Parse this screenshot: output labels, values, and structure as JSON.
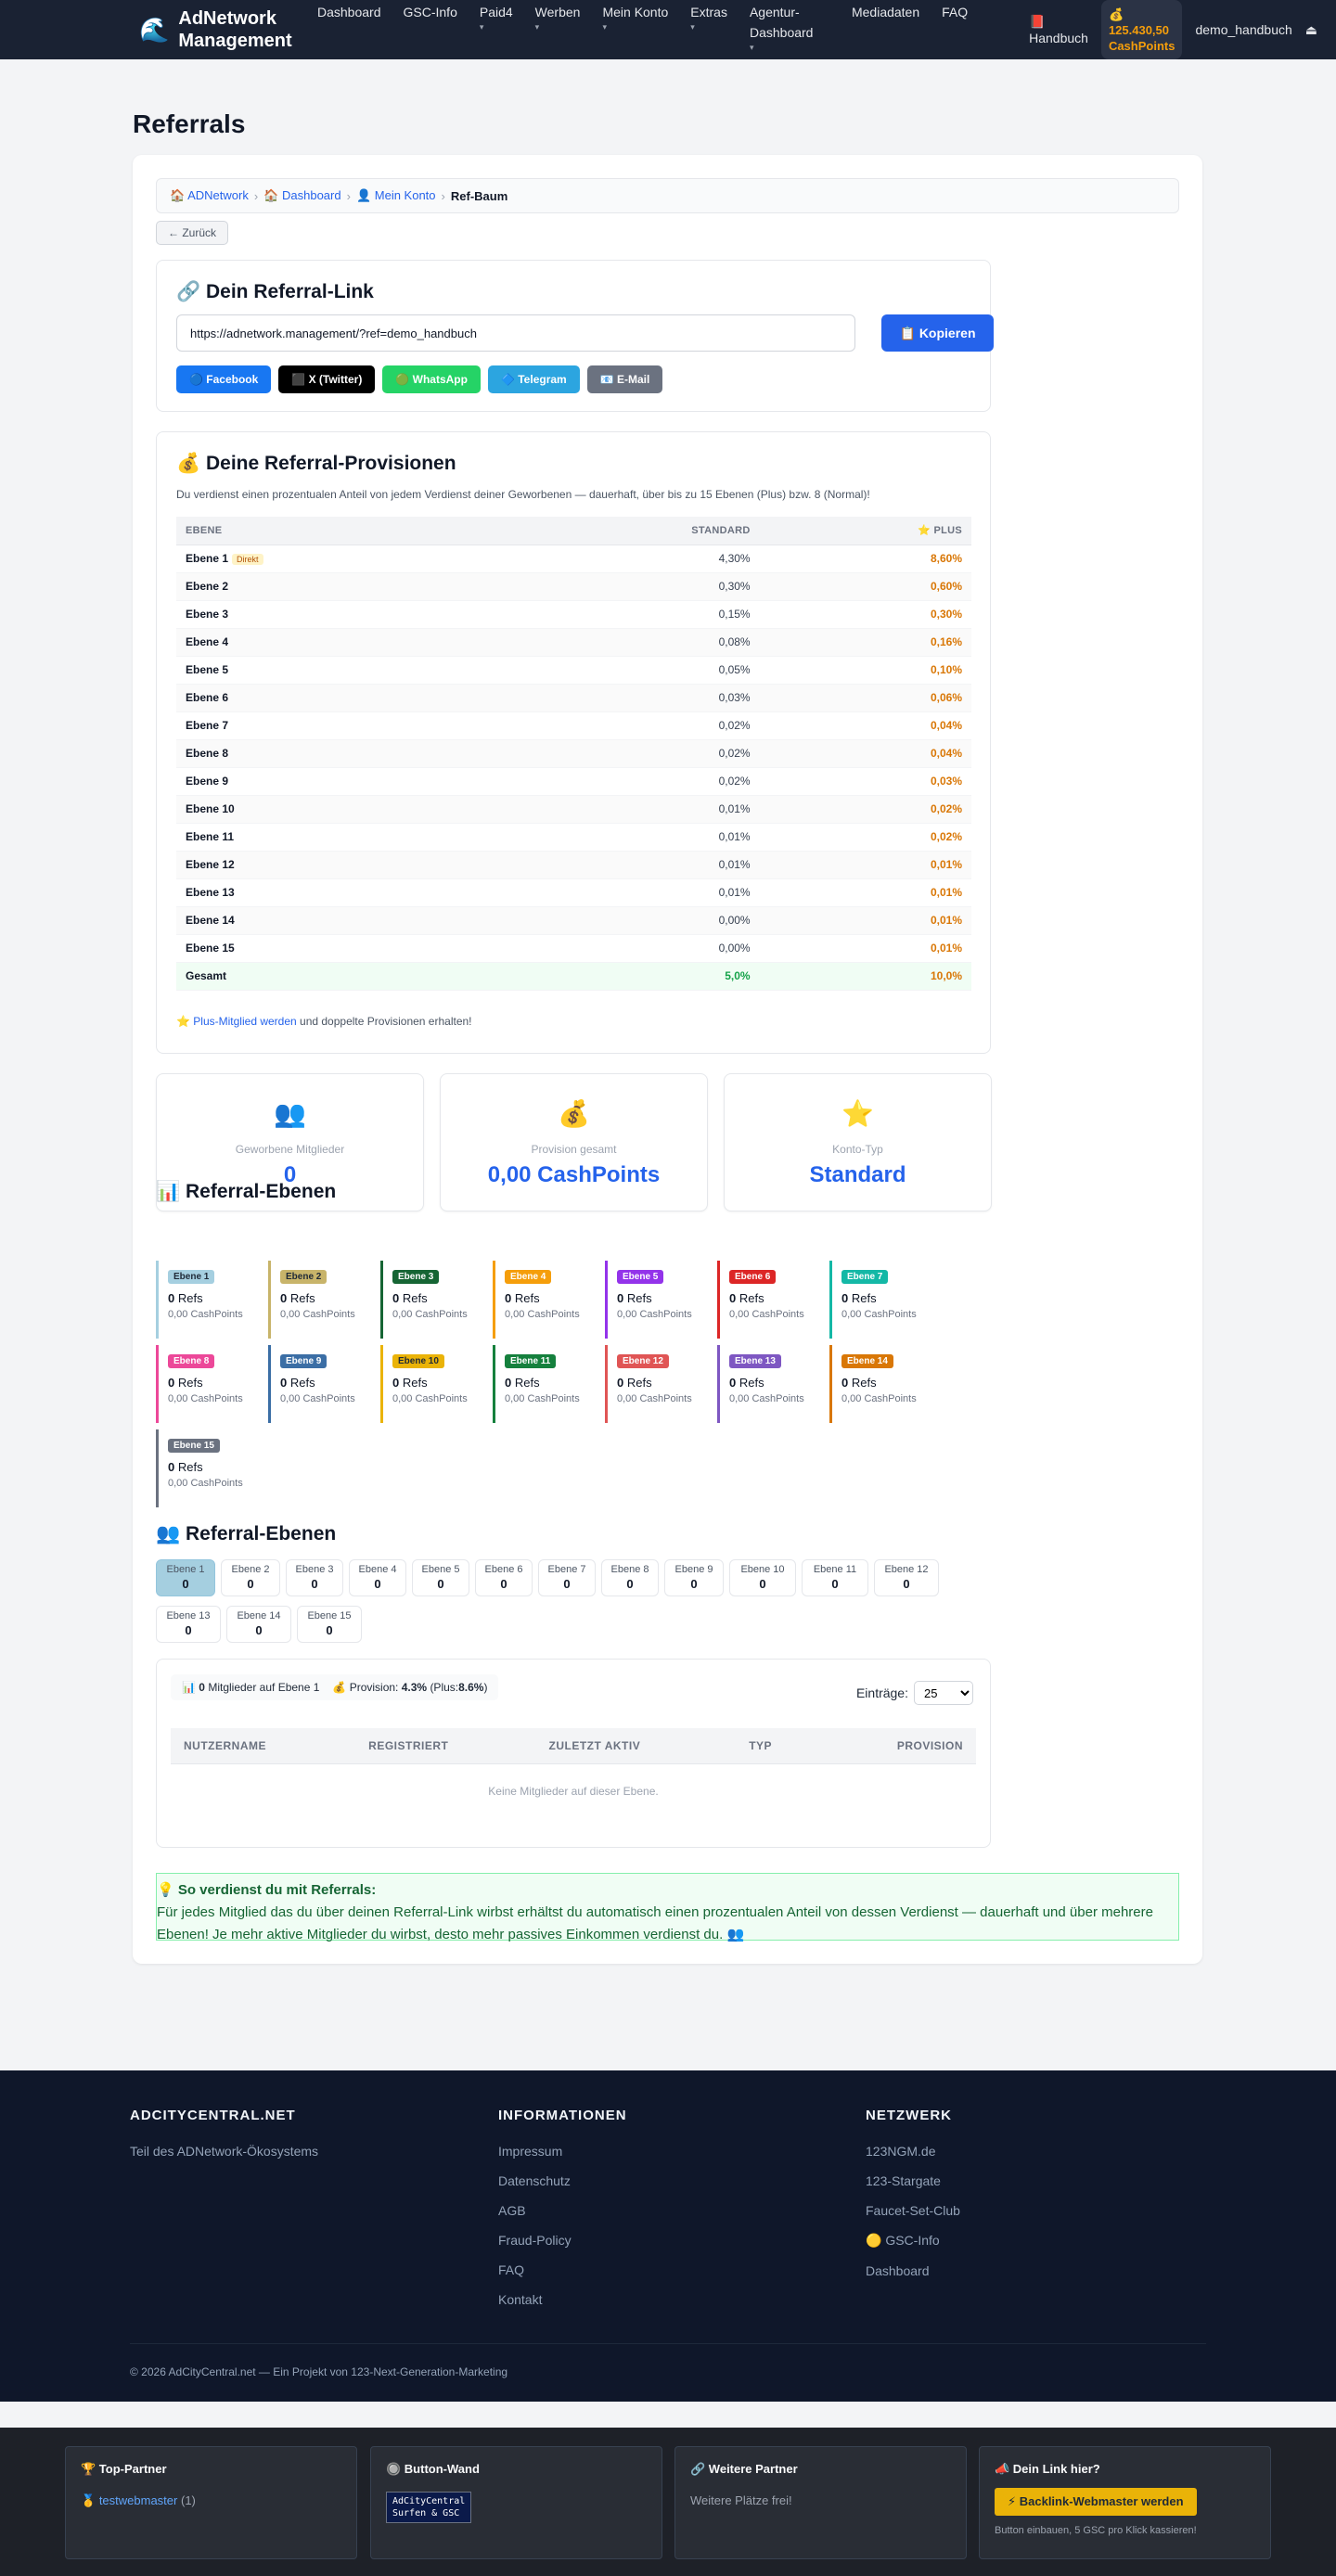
{
  "nav": {
    "brand_icon": "🌊",
    "brand_title": "AdNetwork Management",
    "items": [
      {
        "label": "Dashboard",
        "caret": ""
      },
      {
        "label": "GSC-Info",
        "caret": ""
      },
      {
        "label": "Paid4",
        "caret": "▾"
      },
      {
        "label": "Werben",
        "caret": "▾"
      },
      {
        "label": "Mein Konto",
        "caret": "▾"
      },
      {
        "label": "Extras",
        "caret": "▾"
      },
      {
        "label": "Agentur-Dashboard",
        "caret": "▾"
      },
      {
        "label": "Mediadaten",
        "caret": ""
      },
      {
        "label": "FAQ",
        "caret": ""
      }
    ],
    "handbook_icon": "📕",
    "handbook": "Handbuch",
    "cash_icon": "💰",
    "cash_amount": "125.430,50",
    "cash_unit": "CashPoints",
    "user": "demo_handbuch",
    "logout_icon": "⏏"
  },
  "page": {
    "title": "Referrals"
  },
  "breadcrumb": [
    {
      "icon": "🏠",
      "label": "ADNetwork"
    },
    {
      "icon": "🏠",
      "label": "Dashboard"
    },
    {
      "icon": "👤",
      "label": "Mein Konto"
    },
    {
      "label": "Ref-Baum"
    }
  ],
  "back_label": "← Zurück",
  "ref_link": {
    "title": "🔗 Dein Referral-Link",
    "url": "https://adnetwork.management/?ref=demo_handbuch",
    "copy_label": "📋 Kopieren",
    "share": [
      {
        "label": "🔵 Facebook",
        "color": "#1877f2"
      },
      {
        "label": "⬛ X (Twitter)",
        "color": "#000000"
      },
      {
        "label": "🟢 WhatsApp",
        "color": "#25d366"
      },
      {
        "label": "🔷 Telegram",
        "color": "#2ca5e0"
      },
      {
        "label": "📧 E-Mail",
        "color": "#6b7280"
      }
    ]
  },
  "provisions": {
    "title": "💰 Deine Referral-Provisionen",
    "description": "Du verdienst einen prozentualen Anteil von jedem Verdienst deiner Geworbenen — dauerhaft, über bis zu 15 Ebenen (Plus) bzw. 8 (Normal)!",
    "headers": {
      "level": "Ebene",
      "standard": "Standard",
      "plus": "⭐ Plus"
    },
    "direkt_label": "Direkt",
    "rows": [
      {
        "level": "Ebene 1",
        "standard": "4,30%",
        "plus": "8,60%"
      },
      {
        "level": "Ebene 2",
        "standard": "0,30%",
        "plus": "0,60%"
      },
      {
        "level": "Ebene 3",
        "standard": "0,15%",
        "plus": "0,30%"
      },
      {
        "level": "Ebene 4",
        "standard": "0,08%",
        "plus": "0,16%"
      },
      {
        "level": "Ebene 5",
        "standard": "0,05%",
        "plus": "0,10%"
      },
      {
        "level": "Ebene 6",
        "standard": "0,03%",
        "plus": "0,06%"
      },
      {
        "level": "Ebene 7",
        "standard": "0,02%",
        "plus": "0,04%"
      },
      {
        "level": "Ebene 8",
        "standard": "0,02%",
        "plus": "0,04%"
      },
      {
        "level": "Ebene 9",
        "standard": "0,02%",
        "plus": "0,03%"
      },
      {
        "level": "Ebene 10",
        "standard": "0,01%",
        "plus": "0,02%"
      },
      {
        "level": "Ebene 11",
        "standard": "0,01%",
        "plus": "0,02%"
      },
      {
        "level": "Ebene 12",
        "standard": "0,01%",
        "plus": "0,01%"
      },
      {
        "level": "Ebene 13",
        "standard": "0,01%",
        "plus": "0,01%"
      },
      {
        "level": "Ebene 14",
        "standard": "0,00%",
        "plus": "0,01%"
      },
      {
        "level": "Ebene 15",
        "standard": "0,00%",
        "plus": "0,01%"
      }
    ],
    "total": {
      "level": "Gesamt",
      "standard": "5,0%",
      "plus": "10,0%"
    },
    "plus_note_star": "⭐",
    "plus_note_link": "Plus-Mitglied werden",
    "plus_note_text": "und doppelte Provisionen erhalten!"
  },
  "stats": [
    {
      "icon": "👥",
      "label": "Geworbene Mitglieder",
      "value": "0"
    },
    {
      "icon": "💰",
      "label": "Provision gesamt",
      "value": "0,00 CashPoints"
    },
    {
      "icon": "⭐",
      "label": "Konto-Typ",
      "value": "Standard"
    }
  ],
  "levels_section": {
    "title": "📊 Referral-Ebenen",
    "refs_label": "Refs",
    "cards": [
      {
        "name": "Ebene 1",
        "refs": "0",
        "cash": "0,00 CashPoints",
        "color": "#a5cfe0",
        "text": "#1f2937"
      },
      {
        "name": "Ebene 2",
        "refs": "0",
        "cash": "0,00 CashPoints",
        "color": "#c8b46a",
        "text": "#1f2937"
      },
      {
        "name": "Ebene 3",
        "refs": "0",
        "cash": "0,00 CashPoints",
        "color": "#166534",
        "text": "#ffffff"
      },
      {
        "name": "Ebene 4",
        "refs": "0",
        "cash": "0,00 CashPoints",
        "color": "#f59e0b",
        "text": "#ffffff"
      },
      {
        "name": "Ebene 5",
        "refs": "0",
        "cash": "0,00 CashPoints",
        "color": "#9333ea",
        "text": "#ffffff"
      },
      {
        "name": "Ebene 6",
        "refs": "0",
        "cash": "0,00 CashPoints",
        "color": "#dc2626",
        "text": "#ffffff"
      },
      {
        "name": "Ebene 7",
        "refs": "0",
        "cash": "0,00 CashPoints",
        "color": "#14b8a6",
        "text": "#ffffff"
      },
      {
        "name": "Ebene 8",
        "refs": "0",
        "cash": "0,00 CashPoints",
        "color": "#ec4899",
        "text": "#ffffff"
      },
      {
        "name": "Ebene 9",
        "refs": "0",
        "cash": "0,00 CashPoints",
        "color": "#3b6ea5",
        "text": "#ffffff"
      },
      {
        "name": "Ebene 10",
        "refs": "0",
        "cash": "0,00 CashPoints",
        "color": "#eab308",
        "text": "#1f2937"
      },
      {
        "name": "Ebene 11",
        "refs": "0",
        "cash": "0,00 CashPoints",
        "color": "#15803d",
        "text": "#ffffff"
      },
      {
        "name": "Ebene 12",
        "refs": "0",
        "cash": "0,00 CashPoints",
        "color": "#e05555",
        "text": "#ffffff"
      },
      {
        "name": "Ebene 13",
        "refs": "0",
        "cash": "0,00 CashPoints",
        "color": "#7e57c2",
        "text": "#ffffff"
      },
      {
        "name": "Ebene 14",
        "refs": "0",
        "cash": "0,00 CashPoints",
        "color": "#d97706",
        "text": "#ffffff"
      },
      {
        "name": "Ebene 15",
        "refs": "0",
        "cash": "0,00 CashPoints",
        "color": "#6b7280",
        "text": "#ffffff"
      }
    ]
  },
  "tabs_section": {
    "title": "👥 Referral-Ebenen",
    "tabs": [
      {
        "label": "Ebene 1",
        "count": "0"
      },
      {
        "label": "Ebene 2",
        "count": "0"
      },
      {
        "label": "Ebene 3",
        "count": "0"
      },
      {
        "label": "Ebene 4",
        "count": "0"
      },
      {
        "label": "Ebene 5",
        "count": "0"
      },
      {
        "label": "Ebene 6",
        "count": "0"
      },
      {
        "label": "Ebene 7",
        "count": "0"
      },
      {
        "label": "Ebene 8",
        "count": "0"
      },
      {
        "label": "Ebene 9",
        "count": "0"
      },
      {
        "label": "Ebene 10",
        "count": "0"
      },
      {
        "label": "Ebene 11",
        "count": "0"
      },
      {
        "label": "Ebene 12",
        "count": "0"
      },
      {
        "label": "Ebene 13",
        "count": "0"
      },
      {
        "label": "Ebene 14",
        "count": "0"
      },
      {
        "label": "Ebene 15",
        "count": "0"
      }
    ]
  },
  "members": {
    "summary_icon": "📊",
    "summary_count": "0",
    "summary_text": "Mitglieder auf Ebene 1",
    "prov_icon": "💰",
    "prov_label": "Provision:",
    "prov_value": "4.3%",
    "prov_plus_label": "(Plus:",
    "prov_plus_value": "8.6%",
    "prov_close": ")",
    "entries_label": "Einträge:",
    "entries_value": "25",
    "columns": [
      "Nutzername",
      "Registriert",
      "Zuletzt aktiv",
      "Typ",
      "Provision"
    ],
    "empty": "Keine Mitglieder auf dieser Ebene."
  },
  "info": {
    "title": "💡 So verdienst du mit Referrals:",
    "text": "Für jedes Mitglied das du über deinen Referral-Link wirbst erhältst du automatisch einen prozentualen Anteil von dessen Verdienst — dauerhaft und über mehrere Ebenen! Je mehr aktive Mitglieder du wirbst, desto mehr passives Einkommen verdienst du. 👥"
  },
  "footer": {
    "col1": {
      "title": "AdCityCentral.net",
      "text": "Teil des ADNetwork-Ökosystems"
    },
    "col2": {
      "title": "Informationen",
      "links": [
        "Impressum",
        "Datenschutz",
        "AGB",
        "Fraud-Policy",
        "FAQ",
        "Kontakt"
      ]
    },
    "col3": {
      "title": "Netzwerk",
      "links": [
        "123NGM.de",
        "123-Stargate",
        "Faucet-Set-Club",
        "🟡 GSC-Info",
        "Dashboard"
      ]
    },
    "copyright": "© 2026 AdCityCentral.net — Ein Projekt von 123-Next-Generation-Marketing"
  },
  "partners": {
    "top": {
      "title": "🏆 Top-Partner",
      "medal": "🥇",
      "name": "testwebmaster",
      "count": "(1)"
    },
    "wall": {
      "title": "🔘 Button-Wand",
      "btn_line1": "AdCityCentral",
      "btn_line2": "Surfen & GSC"
    },
    "more": {
      "title": "🔗 Weitere Partner",
      "text": "Weitere Plätze frei!"
    },
    "link": {
      "title": "📣 Dein Link hier?",
      "button": "⚡ Backlink-Webmaster werden",
      "small": "Button einbauen, 5 GSC pro Klick kassieren!"
    }
  }
}
